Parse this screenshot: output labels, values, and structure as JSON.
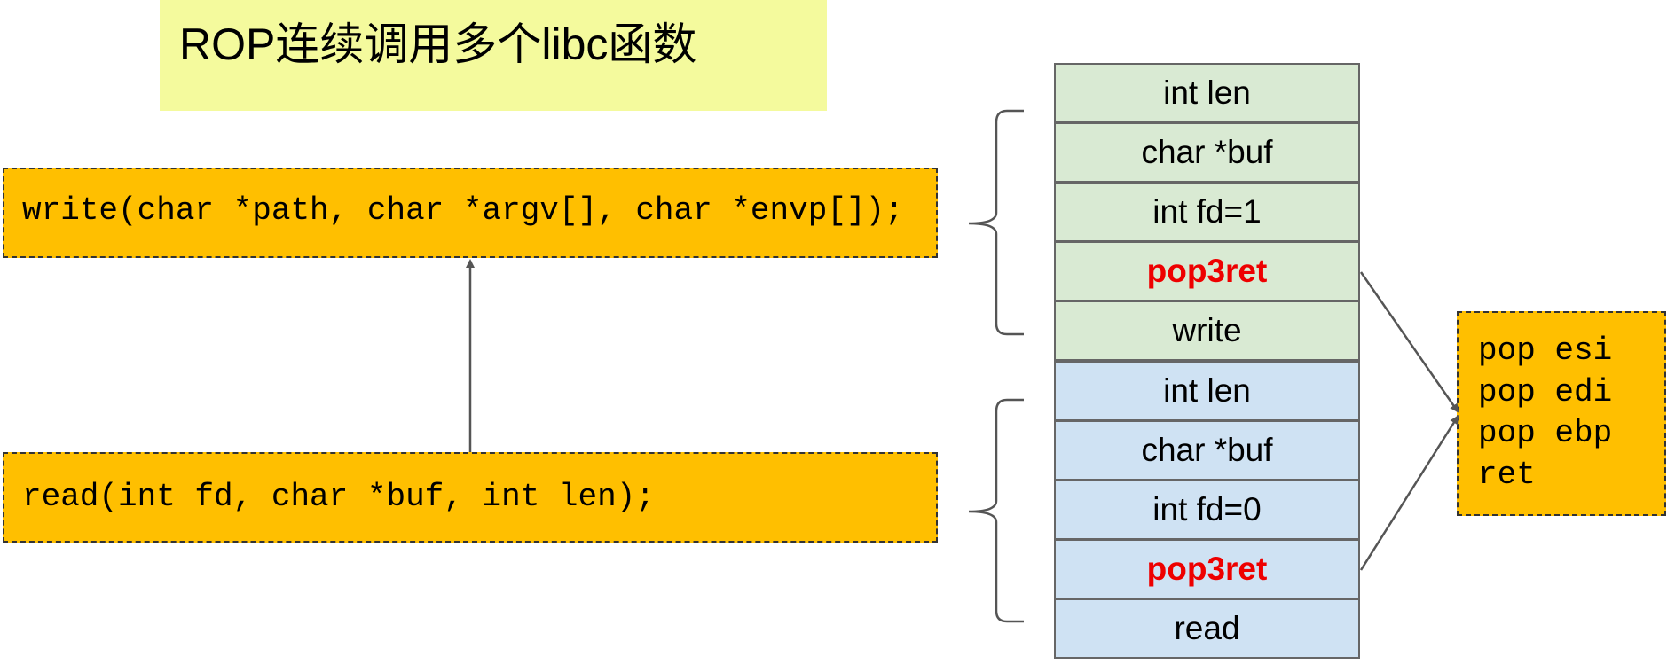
{
  "title": "ROP连续调用多个libc函数",
  "write_call": "write(char *path, char *argv[], char *envp[]);",
  "read_call": "read(int fd, char *buf, int len);",
  "gadget_lines": [
    "pop esi",
    "pop edi",
    "pop ebp",
    "ret"
  ],
  "stack": {
    "write_frame": [
      {
        "label": "int len",
        "highlight": false
      },
      {
        "label": "char *buf",
        "highlight": false
      },
      {
        "label": "int fd=1",
        "highlight": false
      },
      {
        "label": "pop3ret",
        "highlight": true
      },
      {
        "label": "write",
        "highlight": false
      }
    ],
    "read_frame": [
      {
        "label": "int len",
        "highlight": false
      },
      {
        "label": "char *buf",
        "highlight": false
      },
      {
        "label": "int fd=0",
        "highlight": false
      },
      {
        "label": "pop3ret",
        "highlight": true
      },
      {
        "label": "read",
        "highlight": false
      }
    ]
  },
  "colors": {
    "title_bg": "#f4fa9d",
    "code_bg": "#ffbf00",
    "write_frame_bg": "#d9ead3",
    "read_frame_bg": "#cfe2f3",
    "highlight_text": "#ee0000"
  }
}
